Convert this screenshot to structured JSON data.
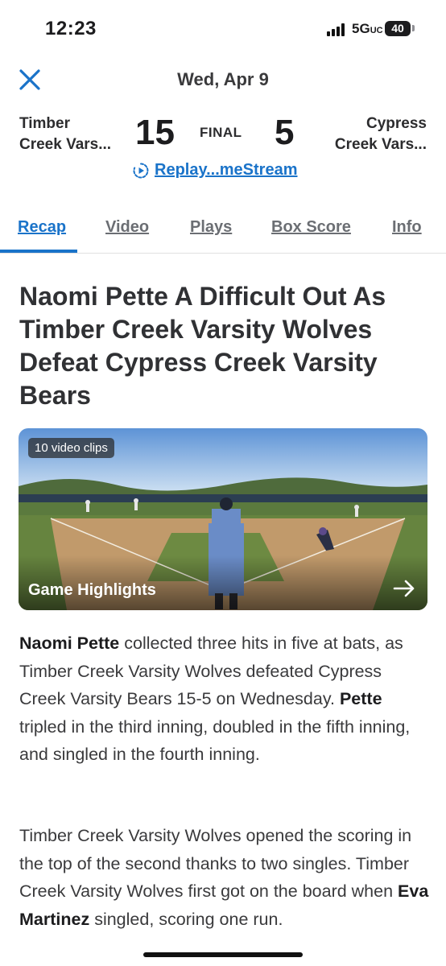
{
  "status": {
    "time": "12:23",
    "network": "5G",
    "network_sub": "UC",
    "battery": "40"
  },
  "header": {
    "date": "Wed, Apr 9"
  },
  "game": {
    "home_team_line1": "Timber",
    "home_team_line2": "Creek Vars...",
    "home_score": "15",
    "status": "FINAL",
    "away_score": "5",
    "away_team_line1": "Cypress",
    "away_team_line2": "Creek Vars...",
    "replay_label": "Replay...meStream"
  },
  "tabs": [
    "Recap",
    "Video",
    "Plays",
    "Box Score",
    "Info"
  ],
  "article": {
    "headline": "Naomi Pette A Difficult Out As Timber Creek Varsity Wolves Defeat Cypress Creek Varsity Bears",
    "video": {
      "clips": "10 video clips",
      "title": "Game Highlights"
    },
    "p1": {
      "name": "Naomi Pette",
      "text_a": " collected three hits in five at bats, as Timber Creek Varsity Wolves defeated Cypress Creek Varsity Bears 15-5 on Wednesday. ",
      "name2": "Pette",
      "text_b": " tripled in the third inning, doubled in the fifth inning, and singled in the fourth inning."
    },
    "p2": {
      "text_a": "Timber Creek Varsity Wolves opened the scoring in the top of the second thanks to two singles. Timber Creek Varsity Wolves first got on the board when ",
      "name": "Eva Martinez",
      "text_b": " singled, scoring one run."
    }
  },
  "colors": {
    "accent": "#1a73c9",
    "text": "#303134",
    "muted_tab": "#6b6e73"
  }
}
